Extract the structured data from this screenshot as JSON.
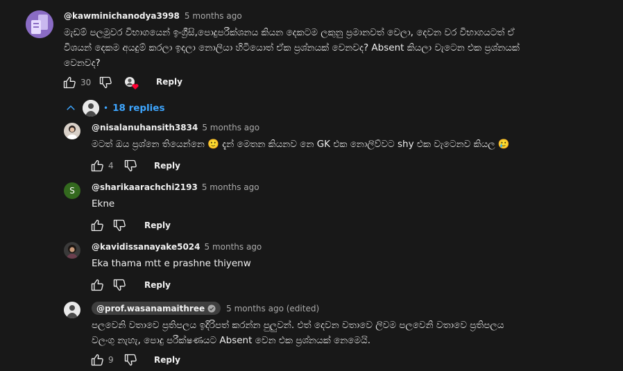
{
  "colors": {
    "background": "#181818",
    "text": "#f1f1f1",
    "muted": "#aaaaaa",
    "link": "#3ea6ff",
    "heart": "#ff0033"
  },
  "main_comment": {
    "author": "@kawminichanodya3998",
    "time": "5 months ago",
    "text_lines": [
      "මැඩම් පලමුවර විභාගයෙන් ඉංග්‍රීසි,පොදුපරීක්ශනය කියන දෙකටම ලකුනු ප්‍රමානවත් වෙලා, දෙවන වර විභාගයටත් ඒ",
      "විශයන් දෙකම අයදුම් කරලා ඉදලා  නොලියා හිටියොත් ඒක ප්‍රශ්නයක් වෙනවද? Absent කියලා වැටෙන එක ප්‍රශ්නයක්",
      "වෙනවද?"
    ],
    "likes": "30",
    "reply_label": "Reply",
    "icons": [
      "thumbs-up-icon",
      "thumbs-down-icon",
      "creator-heart-icon"
    ]
  },
  "replies_toggle": {
    "label": "18 replies",
    "icon": "chevron-up-icon"
  },
  "replies": [
    {
      "author": "@nisalanuhansith3834",
      "time": "5 months ago",
      "text_lines": [
        "මටත් ඔය ප්‍රශ්නෙ තියෙන්නෙ 🙂  දැන් මෙතන කියනව නෙ GK එක නොලිව්වට shy එක වැටෙනව කියල 🥲"
      ],
      "likes": "4",
      "reply_label": "Reply"
    },
    {
      "author": "@sharikaarachchi2193",
      "time": "5 months ago",
      "avatar_letter": "S",
      "text_lines": [
        "Ekne"
      ],
      "likes": "",
      "reply_label": "Reply"
    },
    {
      "author": "@kavidissanayake5024",
      "time": "5 months ago",
      "text_lines": [
        "Eka thama mtt e prashne thiyenw"
      ],
      "likes": "",
      "reply_label": "Reply"
    },
    {
      "author": "@prof.wasanamaithree",
      "time": "5 months ago (edited)",
      "verified_icon": "verified-check-icon",
      "text_lines": [
        "පලවෙනි වතාවෙ ප්‍රතිපලය ඉදිරිපත් කරන්න පුලුවන්.  එත් දෙවන වතාවෙ ලිවම පලවෙනි වතාවෙ ප්‍රතිපලය",
        "වලංගු නැහැ, පොදු පරීක්ෂණයට Absent වෙන එක ප්‍රශ්නයක් නෙමෙයි."
      ],
      "likes": "9",
      "reply_label": "Reply"
    }
  ]
}
